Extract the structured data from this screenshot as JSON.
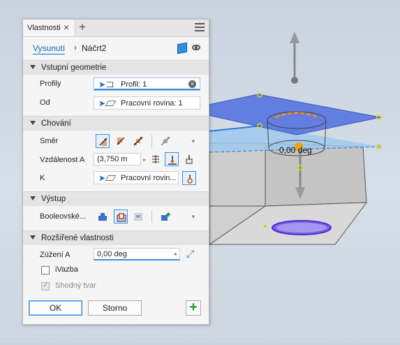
{
  "panel": {
    "tab_title": "Vlastnosti",
    "breadcrumb": {
      "feature": "Vysunutí",
      "sketch": "Náčrt2"
    },
    "sections": {
      "input_geometry": {
        "title": "Vstupní geometrie",
        "profiles_label": "Profily",
        "profiles_value": "Profil: 1",
        "from_label": "Od",
        "from_value": "Pracovní rovina: 1"
      },
      "behavior": {
        "title": "Chování",
        "direction_label": "Směr",
        "distance_label": "Vzdálenost A",
        "distance_value": "(3,750 m",
        "k_label": "K",
        "k_value": "Pracovní rovin..."
      },
      "output": {
        "title": "Výstup",
        "boolean_label": "Booleovské..."
      },
      "advanced": {
        "title": "Rozšířené vlastnosti",
        "taper_label": "Zúžení A",
        "taper_value": "0,00 deg",
        "ivazba_label": "iVazba",
        "match_shape_label": "Shodný tvar"
      }
    },
    "buttons": {
      "ok": "OK",
      "cancel": "Storno"
    }
  },
  "viewport": {
    "dimension_label": "0,00 deg"
  },
  "colors": {
    "accent": "#3b8ee0",
    "link": "#0d6fbd",
    "plane_fill": "#4f6fe0",
    "solid_fill": "#d2d2d2",
    "profile_ellipse": "#6a3ee0",
    "add_green": "#1d9b32"
  }
}
